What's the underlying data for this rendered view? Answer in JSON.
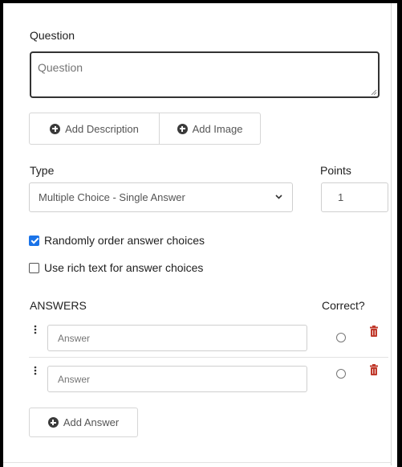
{
  "question": {
    "label": "Question",
    "placeholder": "Question",
    "value": ""
  },
  "buttons": {
    "add_description": "Add Description",
    "add_image": "Add Image",
    "add_answer": "Add Answer"
  },
  "type": {
    "label": "Type",
    "selected": "Multiple Choice - Single Answer"
  },
  "points": {
    "label": "Points",
    "value": "1"
  },
  "options": {
    "random_order": {
      "label": "Randomly order answer choices",
      "checked": true
    },
    "rich_text": {
      "label": "Use rich text for answer choices",
      "checked": false
    }
  },
  "answers": {
    "header": "ANSWERS",
    "correct_header": "Correct?",
    "items": [
      {
        "placeholder": "Answer",
        "value": "",
        "correct": false
      },
      {
        "placeholder": "Answer",
        "value": "",
        "correct": false
      }
    ]
  },
  "colors": {
    "checkbox_accent": "#1a73e8",
    "trash_icon": "#c0392b",
    "border": "#cfcfcf"
  },
  "icons": {
    "add": "plus-circle-icon",
    "select": "chevron-down-icon",
    "drag": "drag-handle-icon",
    "delete": "trash-icon",
    "resize": "resize-grip-icon"
  }
}
